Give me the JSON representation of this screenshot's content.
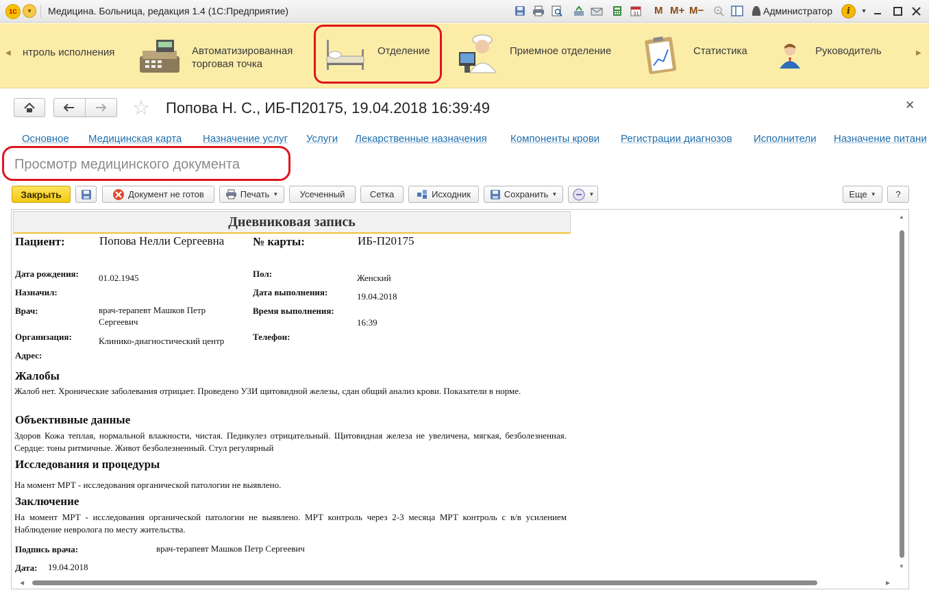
{
  "titlebar": {
    "app_title": "Медицина. Больница, редакция 1.4 (1С:Предприятие)",
    "logo": "1С",
    "m_buttons": [
      "M",
      "M+",
      "M−"
    ],
    "user": "Администратор"
  },
  "sections": [
    {
      "label": "нтроль исполнения"
    },
    {
      "label": "Автоматизированная торговая точка"
    },
    {
      "label": "Отделение"
    },
    {
      "label": "Приемное отделение"
    },
    {
      "label": "Статистика"
    },
    {
      "label": "Руководитель"
    }
  ],
  "form": {
    "title": "Попова Н. С., ИБ-П20175, 19.04.2018 16:39:49",
    "tabs": [
      "Основное",
      "Медицинская карта",
      "Назначение услуг",
      "Услуги",
      "Лекарственные назначения",
      "Компоненты крови",
      "Регистрации диагнозов",
      "Исполнители",
      "Назначение питани"
    ],
    "view_title": "Просмотр медицинского документа"
  },
  "commands": {
    "close": "Закрыть",
    "not_ready": "Документ не готов",
    "print": "Печать",
    "truncated": "Усеченный",
    "grid": "Сетка",
    "source": "Исходник",
    "save": "Сохранить",
    "more": "Еще",
    "help": "?"
  },
  "document": {
    "header": "Дневниковая запись",
    "patient_label": "Пациент:",
    "patient_value": "Попова Нелли Сергеевна",
    "card_label": "№ карты:",
    "card_value": "ИБ-П20175",
    "birth_label": "Дата рождения:",
    "birth_value": "01.02.1945",
    "sex_label": "Пол:",
    "sex_value": "Женский",
    "assigned_label": "Назначил:",
    "exec_date_label": "Дата выполнения:",
    "exec_date_value": "19.04.2018",
    "doctor_label": "Врач:",
    "doctor_value_1": "врач-терапевт Машков Петр",
    "doctor_value_2": "Сергеевич",
    "exec_time_label": "Время выполнения:",
    "exec_time_value": "16:39",
    "org_label": "Организация:",
    "org_value": "Клинико-диагностический центр",
    "phone_label": "Телефон:",
    "address_label": "Адрес:",
    "complaints_title": "Жалобы",
    "complaints_text": "Жалоб нет.  Хронические заболевания отрицает. Проведено УЗИ щитовидной железы, сдан общий анализ крови. Показатели в норме.",
    "objective_title": "Объективные данные",
    "objective_text": "Здоров  Кожа теплая, нормальной влажности, чистая. Педикулез отрицательный. Щитовидная железа не увеличена, мягкая, безболезненная. Сердце: тоны ритмичные. Живот безболезненный. Стул регулярный",
    "research_title": "Исследования и процедуры",
    "research_text": "На момент МРТ - исследования органической патологии не выявлено.",
    "conclusion_title": "Заключение",
    "conclusion_text": "На момент МРТ - исследования органической патологии не выявлено. МРТ контроль через 2-3 месяца МРТ контроль с в/в усилением  Наблюдение невролога по месту жительства.",
    "signature_label": "Подпись врача:",
    "signature_value": "врач-терапевт Машков Петр Сергеевич",
    "date_label": "Дата:",
    "date_value": "19.04.2018"
  }
}
